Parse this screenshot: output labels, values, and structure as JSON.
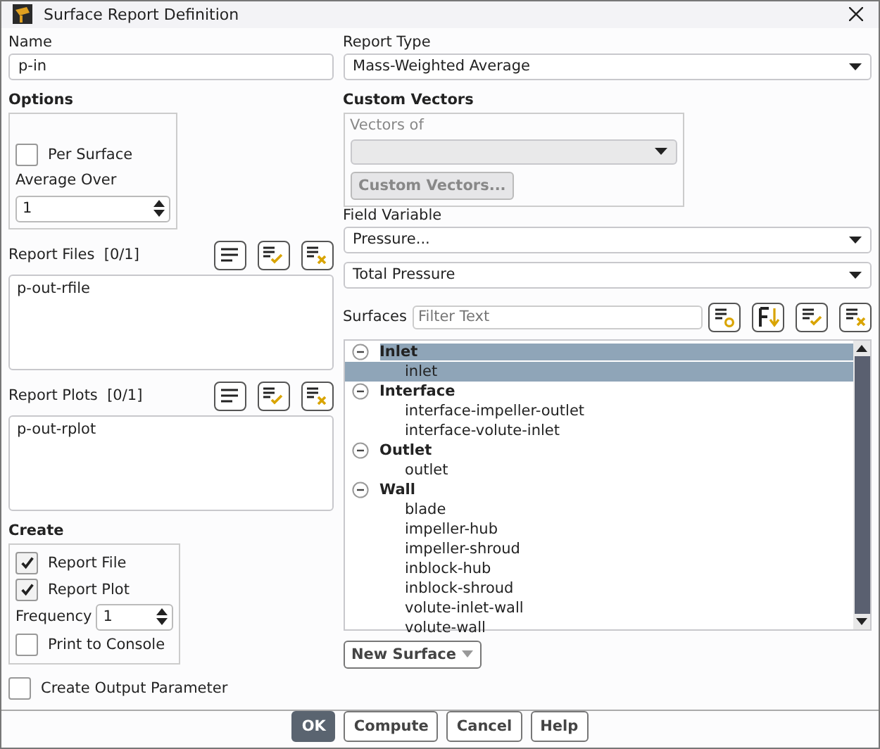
{
  "window": {
    "title": "Surface Report Definition"
  },
  "name": {
    "label": "Name",
    "value": "p-in"
  },
  "options": {
    "title": "Options",
    "per_surface": {
      "label": "Per Surface",
      "checked": false
    },
    "average_over": {
      "label": "Average Over",
      "value": "1"
    }
  },
  "report_files": {
    "label": "Report Files",
    "count": "[0/1]",
    "items": [
      {
        "text": "p-out-rfile",
        "selected": false
      }
    ]
  },
  "report_plots": {
    "label": "Report Plots",
    "count": "[0/1]",
    "items": [
      {
        "text": "p-out-rplot",
        "selected": false
      }
    ]
  },
  "create": {
    "title": "Create",
    "report_file": {
      "label": "Report File",
      "checked": true
    },
    "report_plot": {
      "label": "Report Plot",
      "checked": true
    },
    "frequency": {
      "label": "Frequency",
      "value": "1"
    },
    "print_to_console": {
      "label": "Print to Console",
      "checked": false
    }
  },
  "create_output_parameter": {
    "label": "Create Output Parameter",
    "checked": false
  },
  "report_type": {
    "label": "Report Type",
    "value": "Mass-Weighted Average"
  },
  "custom_vectors": {
    "title": "Custom Vectors",
    "vectors_of": "Vectors of",
    "button": "Custom Vectors...",
    "disabled": true
  },
  "field_variable": {
    "label": "Field Variable",
    "category": "Pressure...",
    "value": "Total Pressure"
  },
  "surfaces": {
    "label": "Surfaces",
    "placeholder": "Filter Text",
    "groups": [
      {
        "name": "Inlet",
        "expanded": true,
        "selected": true,
        "children": [
          {
            "name": "inlet",
            "selected": true
          }
        ]
      },
      {
        "name": "Interface",
        "expanded": true,
        "selected": false,
        "children": [
          {
            "name": "interface-impeller-outlet",
            "selected": false
          },
          {
            "name": "interface-volute-inlet",
            "selected": false
          }
        ]
      },
      {
        "name": "Outlet",
        "expanded": true,
        "selected": false,
        "children": [
          {
            "name": "outlet",
            "selected": false
          }
        ]
      },
      {
        "name": "Wall",
        "expanded": true,
        "selected": false,
        "children": [
          {
            "name": "blade",
            "selected": false
          },
          {
            "name": "impeller-hub",
            "selected": false
          },
          {
            "name": "impeller-shroud",
            "selected": false
          },
          {
            "name": "inblock-hub",
            "selected": false
          },
          {
            "name": "inblock-shroud",
            "selected": false
          },
          {
            "name": "volute-inlet-wall",
            "selected": false
          },
          {
            "name": "volute-wall",
            "selected": false
          }
        ]
      }
    ]
  },
  "new_surface": {
    "label": "New Surface"
  },
  "buttons": [
    {
      "label": "OK",
      "default": true
    },
    {
      "label": "Compute",
      "default": false
    },
    {
      "label": "Cancel",
      "default": false
    },
    {
      "label": "Help",
      "default": false
    }
  ]
}
